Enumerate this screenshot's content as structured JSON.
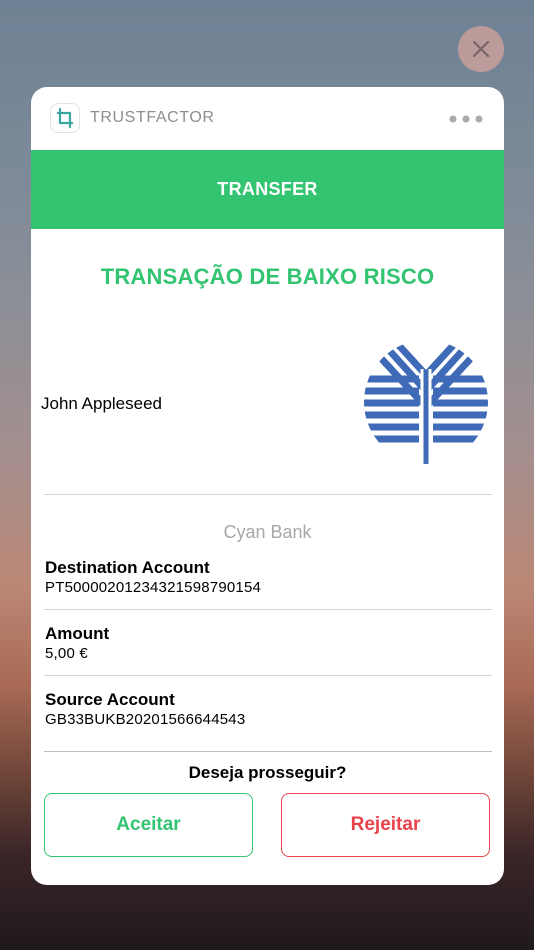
{
  "app": {
    "name": "TRUSTFACTOR"
  },
  "banner": {
    "label": "TRANSFER"
  },
  "risk": {
    "title": "TRANSAÇÃO DE BAIXO RISCO"
  },
  "user": {
    "name": "John Appleseed"
  },
  "bank": {
    "name": "Cyan Bank",
    "logo": "bank-logo-icon"
  },
  "fields": [
    {
      "label": "Destination Account",
      "value": "PT50000201234321598790154"
    },
    {
      "label": "Amount",
      "value": "5,00 €"
    },
    {
      "label": "Source Account",
      "value": "GB33BUKB20201566644543"
    }
  ],
  "prompt": {
    "question": "Deseja prosseguir?"
  },
  "actions": {
    "accept": "Aceitar",
    "reject": "Rejeitar"
  },
  "colors": {
    "accent": "#33c472",
    "danger": "#e8424c",
    "logo": "#3f6ab7"
  }
}
